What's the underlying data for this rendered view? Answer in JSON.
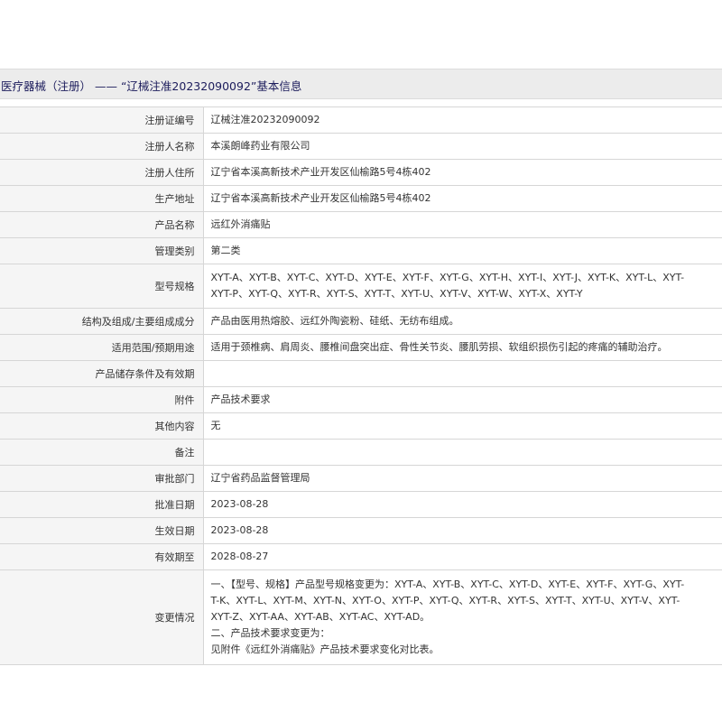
{
  "header": {
    "title": "医疗器械（注册） —— “辽械注准20232090092”基本信息"
  },
  "fields": [
    {
      "label": "注册证编号",
      "lines": [
        "辽械注准20232090092"
      ]
    },
    {
      "label": "注册人名称",
      "lines": [
        "本溪朗峰药业有限公司"
      ]
    },
    {
      "label": "注册人住所",
      "lines": [
        "辽宁省本溪高新技术产业开发区仙榆路5号4栋402"
      ]
    },
    {
      "label": "生产地址",
      "lines": [
        "辽宁省本溪高新技术产业开发区仙榆路5号4栋402"
      ]
    },
    {
      "label": "产品名称",
      "lines": [
        "远红外消痛贴"
      ]
    },
    {
      "label": "管理类别",
      "lines": [
        "第二类"
      ]
    },
    {
      "label": "型号规格",
      "lines": [
        "XYT-A、XYT-B、XYT-C、XYT-D、XYT-E、XYT-F、XYT-G、XYT-H、XYT-I、XYT-J、XYT-K、XYT-L、XYT-",
        "XYT-P、XYT-Q、XYT-R、XYT-S、XYT-T、XYT-U、XYT-V、XYT-W、XYT-X、XYT-Y"
      ]
    },
    {
      "label": "结构及组成/主要组成成分",
      "lines": [
        "产品由医用热熔胶、远红外陶瓷粉、硅纸、无纺布组成。"
      ]
    },
    {
      "label": "适用范围/预期用途",
      "lines": [
        "适用于颈椎病、肩周炎、腰椎间盘突出症、骨性关节炎、腰肌劳损、软组织损伤引起的疼痛的辅助治疗。"
      ]
    },
    {
      "label": "产品储存条件及有效期",
      "lines": [
        ""
      ]
    },
    {
      "label": "附件",
      "lines": [
        "产品技术要求"
      ]
    },
    {
      "label": "其他内容",
      "lines": [
        "无"
      ]
    },
    {
      "label": "备注",
      "lines": [
        ""
      ]
    },
    {
      "label": "审批部门",
      "lines": [
        "辽宁省药品监督管理局"
      ]
    },
    {
      "label": "批准日期",
      "lines": [
        "2023-08-28"
      ]
    },
    {
      "label": "生效日期",
      "lines": [
        "2023-08-28"
      ]
    },
    {
      "label": "有效期至",
      "lines": [
        "2028-08-27"
      ]
    },
    {
      "label": "变更情况",
      "lines": [
        "一、【型号、规格】产品型号规格变更为：XYT-A、XYT-B、XYT-C、XYT-D、XYT-E、XYT-F、XYT-G、XYT-",
        "T-K、XYT-L、XYT-M、XYT-N、XYT-O、XYT-P、XYT-Q、XYT-R、XYT-S、XYT-T、XYT-U、XYT-V、XYT-",
        "XYT-Z、XYT-AA、XYT-AB、XYT-AC、XYT-AD。",
        "二、产品技术要求变更为：",
        "见附件《远红外消痛贴》产品技术要求变化对比表。"
      ]
    }
  ]
}
